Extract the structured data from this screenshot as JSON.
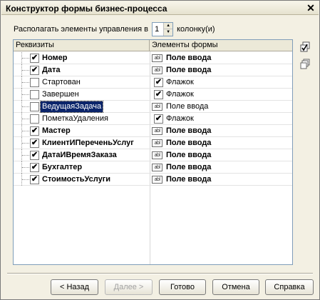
{
  "window": {
    "title": "Конструктор формы бизнес-процесса",
    "close_symbol": "✕"
  },
  "columns": {
    "label_before": "Располагать элементы управления в",
    "value": "1",
    "label_after": "колонку(и)"
  },
  "grid": {
    "headers": [
      "Реквизиты",
      "Элементы формы"
    ],
    "rows": [
      {
        "name": "Номер",
        "checked": true,
        "bold": true,
        "element": "Поле ввода",
        "element_type": "input-field-icon"
      },
      {
        "name": "Дата",
        "checked": true,
        "bold": true,
        "element": "Поле ввода",
        "element_type": "input-field-icon"
      },
      {
        "name": "Стартован",
        "checked": false,
        "bold": false,
        "element": "Флажок",
        "element_type": "checkbox-element"
      },
      {
        "name": "Завершен",
        "checked": false,
        "bold": false,
        "element": "Флажок",
        "element_type": "checkbox-element"
      },
      {
        "name": "ВедущаяЗадача",
        "checked": false,
        "bold": false,
        "selected": true,
        "element": "Поле ввода",
        "element_type": "input-field-icon"
      },
      {
        "name": "ПометкаУдаления",
        "checked": false,
        "bold": false,
        "element": "Флажок",
        "element_type": "checkbox-element"
      },
      {
        "name": "Мастер",
        "checked": true,
        "bold": true,
        "element": "Поле ввода",
        "element_type": "input-field-icon"
      },
      {
        "name": "КлиентИПереченьУслуг",
        "checked": true,
        "bold": true,
        "element": "Поле ввода",
        "element_type": "input-field-icon"
      },
      {
        "name": "ДатаИВремяЗаказа",
        "checked": true,
        "bold": true,
        "element": "Поле ввода",
        "element_type": "input-field-icon"
      },
      {
        "name": "Бухгалтер",
        "checked": true,
        "bold": true,
        "element": "Поле ввода",
        "element_type": "input-field-icon"
      },
      {
        "name": "СтоимостьУслуги",
        "checked": true,
        "bold": true,
        "element": "Поле ввода",
        "element_type": "input-field-icon"
      }
    ],
    "icon_text": "abl",
    "check_mark": "✔",
    "selection_color": "#0a246a"
  },
  "side_buttons": {
    "b1_icon": "check-all-icon",
    "b2_icon": "copy-icon"
  },
  "buttons": {
    "back": "< Назад",
    "next": "Далее >",
    "done": "Готово",
    "cancel": "Отмена",
    "help": "Справка"
  }
}
